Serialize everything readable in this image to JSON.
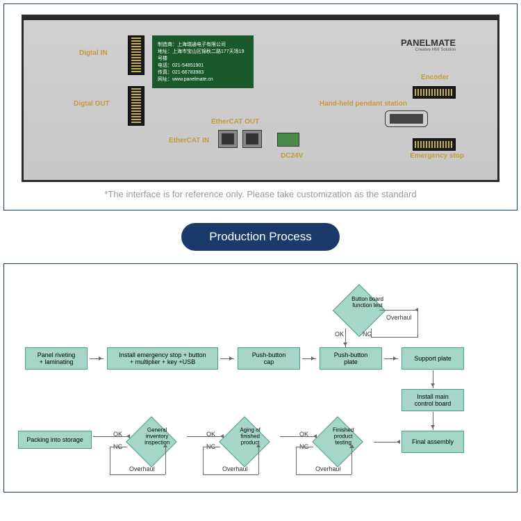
{
  "panel": {
    "labels": {
      "digital_in": "Digtal IN",
      "digital_out": "Digtal OUT",
      "ethercat_in": "EtherCAT IN",
      "ethercat_out": "EtherCAT OUT",
      "dc24v": "DC24V",
      "encoder": "Encoder",
      "pendant": "Hand-held pendant station",
      "estop": "Emergency stop"
    },
    "brand": "PANELMATE",
    "brand_sub": "Creative HMI Solution",
    "info": [
      "制造商：上海瑞通电子有限公司",
      "地址：上海市宝山区锦秋二路177天场19号楼",
      "电话：021-54851901",
      "传真：021-66783983",
      "网址：www.panelmate.cn"
    ],
    "ref": "*The interface is for reference only. Please take customization as the standard"
  },
  "section": "Production Process",
  "flow": {
    "n1": "Panel riveting\n+ laminating",
    "n2": "Install emergency stop + button\n+ multiplier + key +USB",
    "n3": "Push-button\ncap",
    "n4": "Push-button\nplate",
    "n5": "Support plate",
    "n6": "Install main\ncontrol board",
    "n7": "Final assembly",
    "n8": "Finished product\ntesting",
    "n9": "Aging of finished\nproduct",
    "n10": "General inventory\ninspection",
    "n11": "Packing into storage",
    "d1": "Button board\nfunction test",
    "ok": "OK",
    "ng": "NG",
    "oh": "Overhaul"
  }
}
